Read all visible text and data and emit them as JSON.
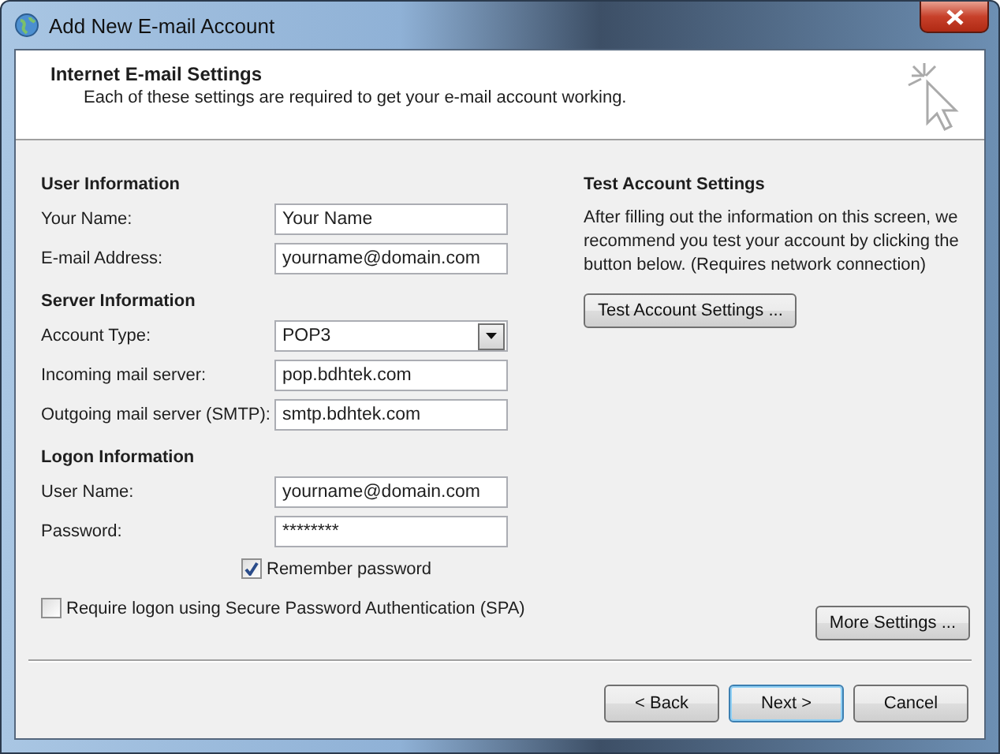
{
  "window": {
    "title": "Add New E-mail Account"
  },
  "header": {
    "title": "Internet E-mail Settings",
    "subtitle": "Each of these settings are required to get your e-mail account working."
  },
  "sections": [
    {
      "heading": "User Information",
      "fields": [
        {
          "kind": "text",
          "label": "Your Name:",
          "value": "Your Name"
        },
        {
          "kind": "text",
          "label": "E-mail Address:",
          "value": "yourname@domain.com"
        }
      ]
    },
    {
      "heading": "Server Information",
      "fields": [
        {
          "kind": "dropdown",
          "label": "Account Type:",
          "value": "POP3"
        },
        {
          "kind": "text",
          "label": "Incoming mail server:",
          "value": "pop.bdhtek.com"
        },
        {
          "kind": "text",
          "label": "Outgoing mail server (SMTP):",
          "value": "smtp.bdhtek.com"
        }
      ]
    },
    {
      "heading": "Logon Information",
      "fields": [
        {
          "kind": "text",
          "label": "User Name:",
          "value": "yourname@domain.com"
        },
        {
          "kind": "password",
          "label": "Password:",
          "value": "********"
        }
      ]
    }
  ],
  "remember_password": {
    "label": "Remember password",
    "checked": true
  },
  "spa": {
    "label": "Require logon using Secure Password Authentication (SPA)",
    "checked": false
  },
  "test": {
    "heading": "Test Account Settings",
    "description": "After filling out the information on this screen, we recommend you test your account by clicking the button below. (Requires network connection)",
    "button": "Test Account Settings ..."
  },
  "more_settings": "More Settings ...",
  "buttons": [
    {
      "label": "< Back",
      "default": false
    },
    {
      "label": "Next >",
      "default": true
    },
    {
      "label": "Cancel",
      "default": false
    }
  ]
}
